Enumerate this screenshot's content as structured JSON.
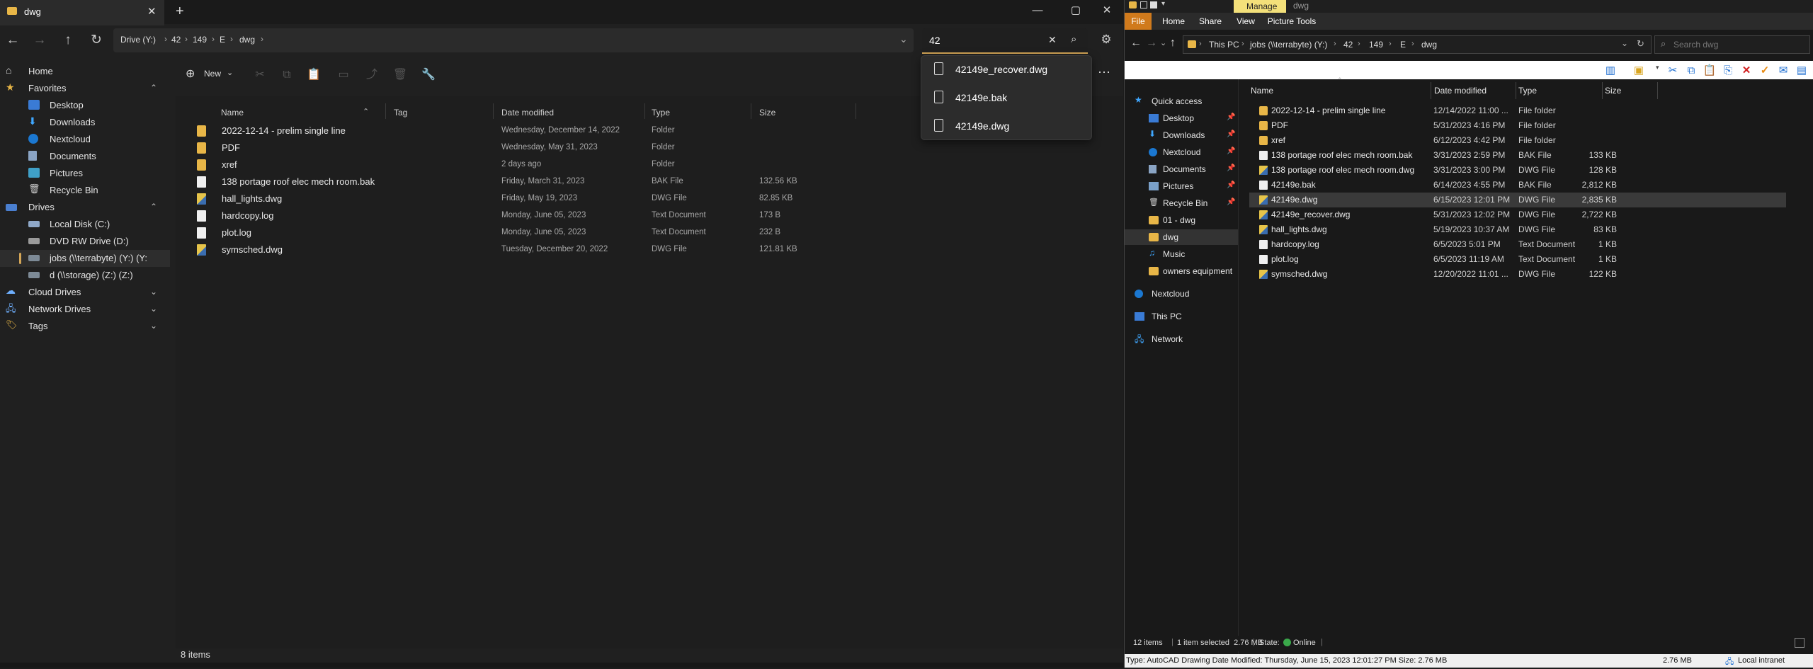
{
  "files_app": {
    "tab_title": "dwg",
    "tab_close": "✕",
    "new_tab": "+",
    "window_controls": [
      "—",
      "▢",
      "✕"
    ],
    "breadcrumb": [
      "Drive (Y:)",
      "42",
      "149",
      "E",
      "dwg"
    ],
    "search_value": "42",
    "toolbar": {
      "new_label": "New"
    },
    "search_suggestions": [
      "42149e_recover.dwg",
      "42149e.bak",
      "42149e.dwg"
    ],
    "sidebar": {
      "home": "Home",
      "favorites": "Favorites",
      "favorites_items": [
        "Desktop",
        "Downloads",
        "Nextcloud",
        "Documents",
        "Pictures",
        "Recycle Bin"
      ],
      "drives": "Drives",
      "drives_items": [
        "Local Disk (C:)",
        "DVD RW Drive (D:)",
        "jobs (\\\\terrabyte) (Y:) (Y:",
        "d (\\\\storage) (Z:) (Z:)"
      ],
      "cloud_drives": "Cloud Drives",
      "network_drives": "Network Drives",
      "tags": "Tags"
    },
    "columns": {
      "name": "Name",
      "tag": "Tag",
      "date": "Date modified",
      "type": "Type",
      "size": "Size"
    },
    "rows": [
      {
        "name": "2022-12-14 - prelim single line",
        "date": "Wednesday, December 14, 2022",
        "type": "Folder",
        "size": "",
        "kind": "folder"
      },
      {
        "name": "PDF",
        "date": "Wednesday, May 31, 2023",
        "type": "Folder",
        "size": "",
        "kind": "folder"
      },
      {
        "name": "xref",
        "date": "2 days ago",
        "type": "Folder",
        "size": "",
        "kind": "folder"
      },
      {
        "name": "138 portage roof elec mech room.bak",
        "date": "Friday, March 31, 2023",
        "type": "BAK File",
        "size": "132.56 KB",
        "kind": "file"
      },
      {
        "name": "hall_lights.dwg",
        "date": "Friday, May 19, 2023",
        "type": "DWG File",
        "size": "82.85 KB",
        "kind": "dwg"
      },
      {
        "name": "hardcopy.log",
        "date": "Monday, June 05, 2023",
        "type": "Text Document",
        "size": "173 B",
        "kind": "file"
      },
      {
        "name": "plot.log",
        "date": "Monday, June 05, 2023",
        "type": "Text Document",
        "size": "232 B",
        "kind": "file"
      },
      {
        "name": "symsched.dwg",
        "date": "Tuesday, December 20, 2022",
        "type": "DWG File",
        "size": "121.81 KB",
        "kind": "dwg"
      }
    ],
    "status": "8 items"
  },
  "explorer": {
    "title": "dwg",
    "manage_tab": "Manage",
    "ribbon_tabs": [
      "File",
      "Home",
      "Share",
      "View",
      "Picture Tools"
    ],
    "breadcrumb": [
      "This PC",
      "jobs (\\\\terrabyte) (Y:)",
      "42",
      "149",
      "E",
      "dwg"
    ],
    "search_placeholder": "Search dwg",
    "columns": {
      "name": "Name",
      "date": "Date modified",
      "type": "Type",
      "size": "Size"
    },
    "sidebar": {
      "quick_access": "Quick access",
      "quick_items": [
        "Desktop",
        "Downloads",
        "Nextcloud",
        "Documents",
        "Pictures",
        "Recycle Bin",
        "01 - dwg",
        "dwg",
        "Music",
        "owners equipment"
      ],
      "nextcloud": "Nextcloud",
      "this_pc": "This PC",
      "network": "Network"
    },
    "rows": [
      {
        "name": "2022-12-14 - prelim single line",
        "date": "12/14/2022 11:00 ...",
        "type": "File folder",
        "size": "",
        "kind": "folder"
      },
      {
        "name": "PDF",
        "date": "5/31/2023 4:16 PM",
        "type": "File folder",
        "size": "",
        "kind": "folder"
      },
      {
        "name": "xref",
        "date": "6/12/2023 4:42 PM",
        "type": "File folder",
        "size": "",
        "kind": "folder"
      },
      {
        "name": "138 portage roof elec mech room.bak",
        "date": "3/31/2023 2:59 PM",
        "type": "BAK File",
        "size": "133 KB",
        "kind": "file"
      },
      {
        "name": "138 portage roof elec mech room.dwg",
        "date": "3/31/2023 3:00 PM",
        "type": "DWG File",
        "size": "128 KB",
        "kind": "dwg"
      },
      {
        "name": "42149e.bak",
        "date": "6/14/2023 4:55 PM",
        "type": "BAK File",
        "size": "2,812 KB",
        "kind": "file"
      },
      {
        "name": "42149e.dwg",
        "date": "6/15/2023 12:01 PM",
        "type": "DWG File",
        "size": "2,835 KB",
        "kind": "dwg"
      },
      {
        "name": "42149e_recover.dwg",
        "date": "5/31/2023 12:02 PM",
        "type": "DWG File",
        "size": "2,722 KB",
        "kind": "dwg"
      },
      {
        "name": "hall_lights.dwg",
        "date": "5/19/2023 10:37 AM",
        "type": "DWG File",
        "size": "83 KB",
        "kind": "dwg"
      },
      {
        "name": "hardcopy.log",
        "date": "6/5/2023 5:01 PM",
        "type": "Text Document",
        "size": "1 KB",
        "kind": "file"
      },
      {
        "name": "plot.log",
        "date": "6/5/2023 11:19 AM",
        "type": "Text Document",
        "size": "1 KB",
        "kind": "file"
      },
      {
        "name": "symsched.dwg",
        "date": "12/20/2022 11:01 ...",
        "type": "DWG File",
        "size": "122 KB",
        "kind": "dwg"
      }
    ],
    "selected_index": 6,
    "status": {
      "items": "12 items",
      "selected": "1 item selected  2.76 MB",
      "state_label": "State:",
      "state_value": "Online"
    },
    "info_bar": {
      "text": "Type: AutoCAD Drawing Date Modified: Thursday, June 15, 2023 12:01:27 PM Size: 2.76 MB",
      "size": "2.76 MB",
      "zone": "Local intranet"
    }
  }
}
